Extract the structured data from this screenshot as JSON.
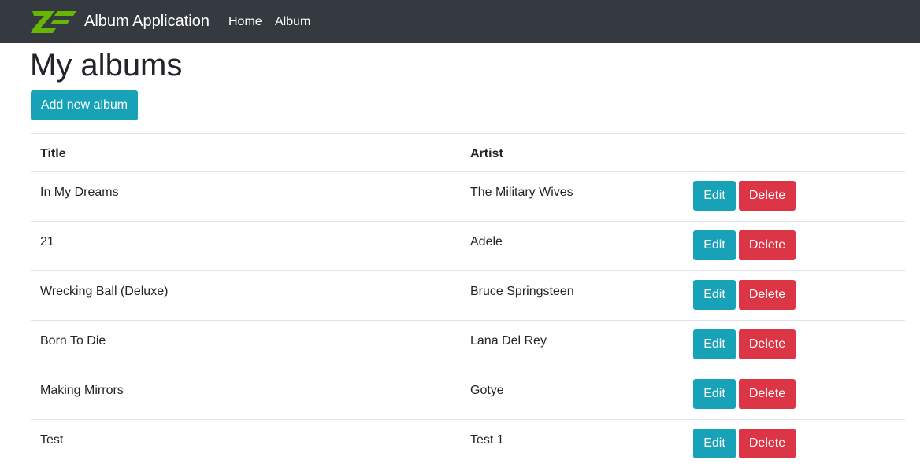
{
  "brand": {
    "name": "Album Application"
  },
  "nav": {
    "home": "Home",
    "album": "Album"
  },
  "page": {
    "title": "My albums",
    "add_button": "Add new album"
  },
  "table": {
    "headers": {
      "title": "Title",
      "artist": "Artist"
    },
    "rows": [
      {
        "title": "In My Dreams",
        "artist": "The Military Wives",
        "edit": "Edit",
        "delete": "Delete"
      },
      {
        "title": "21",
        "artist": "Adele",
        "edit": "Edit",
        "delete": "Delete"
      },
      {
        "title": "Wrecking Ball (Deluxe)",
        "artist": "Bruce Springsteen",
        "edit": "Edit",
        "delete": "Delete"
      },
      {
        "title": "Born To Die",
        "artist": "Lana Del Rey",
        "edit": "Edit",
        "delete": "Delete"
      },
      {
        "title": "Making Mirrors",
        "artist": "Gotye",
        "edit": "Edit",
        "delete": "Delete"
      },
      {
        "title": "Test",
        "artist": "Test 1",
        "edit": "Edit",
        "delete": "Delete"
      }
    ]
  },
  "colors": {
    "navbar": "#343a40",
    "brand_logo": "#68b604",
    "info_button": "#17a2b8",
    "danger_button": "#dc3545",
    "border": "#dee2e6"
  },
  "icons": {
    "brand_logo": "zf-logo-icon"
  }
}
